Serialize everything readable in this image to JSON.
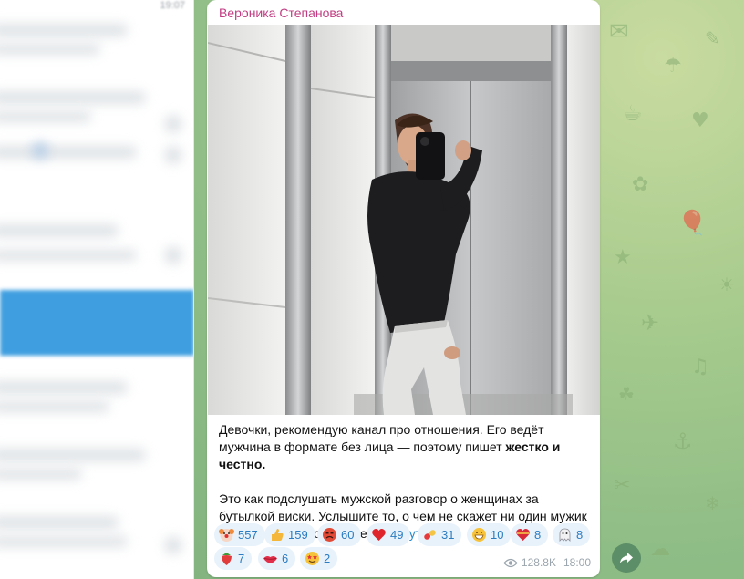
{
  "sidebar": {
    "time": "19:07"
  },
  "message": {
    "author": "Вероника Степанова",
    "photo_alt": "Фото в лифте",
    "caption": {
      "p1_plain": "Девочки, рекомендую канал про отношения. Его ведёт мужчина в формате без лица — поэтому пишет ",
      "p1_bold": "жестко и честно.",
      "p2_plain": "Это как подслушать мужской разговор о женщинах за бутылкой виски. Услышите то, о чем не скажет ни один мужик глядя в глаза. Почитайте: ",
      "p2_link": "москоутиндер"
    },
    "reactions": [
      {
        "emoji": "clown-face",
        "count": "557"
      },
      {
        "emoji": "thumbs-up",
        "count": "159"
      },
      {
        "emoji": "angry-face",
        "count": "60"
      },
      {
        "emoji": "red-heart",
        "count": "49"
      },
      {
        "emoji": "pill",
        "count": "31"
      },
      {
        "emoji": "grinning-face",
        "count": "10"
      },
      {
        "emoji": "heart-with-ribbon",
        "count": "8"
      },
      {
        "emoji": "ghost",
        "count": "8"
      },
      {
        "emoji": "strawberry",
        "count": "7"
      },
      {
        "emoji": "kiss-lips",
        "count": "6"
      },
      {
        "emoji": "star-struck",
        "count": "2"
      }
    ],
    "views": "128.8K",
    "time": "18:00"
  },
  "colors": {
    "author": "#c03d82",
    "link": "#2a8acb",
    "reaction_bg": "#e8f2fb",
    "reaction_text": "#2b7cc1",
    "share_button": "#5c8e67"
  }
}
